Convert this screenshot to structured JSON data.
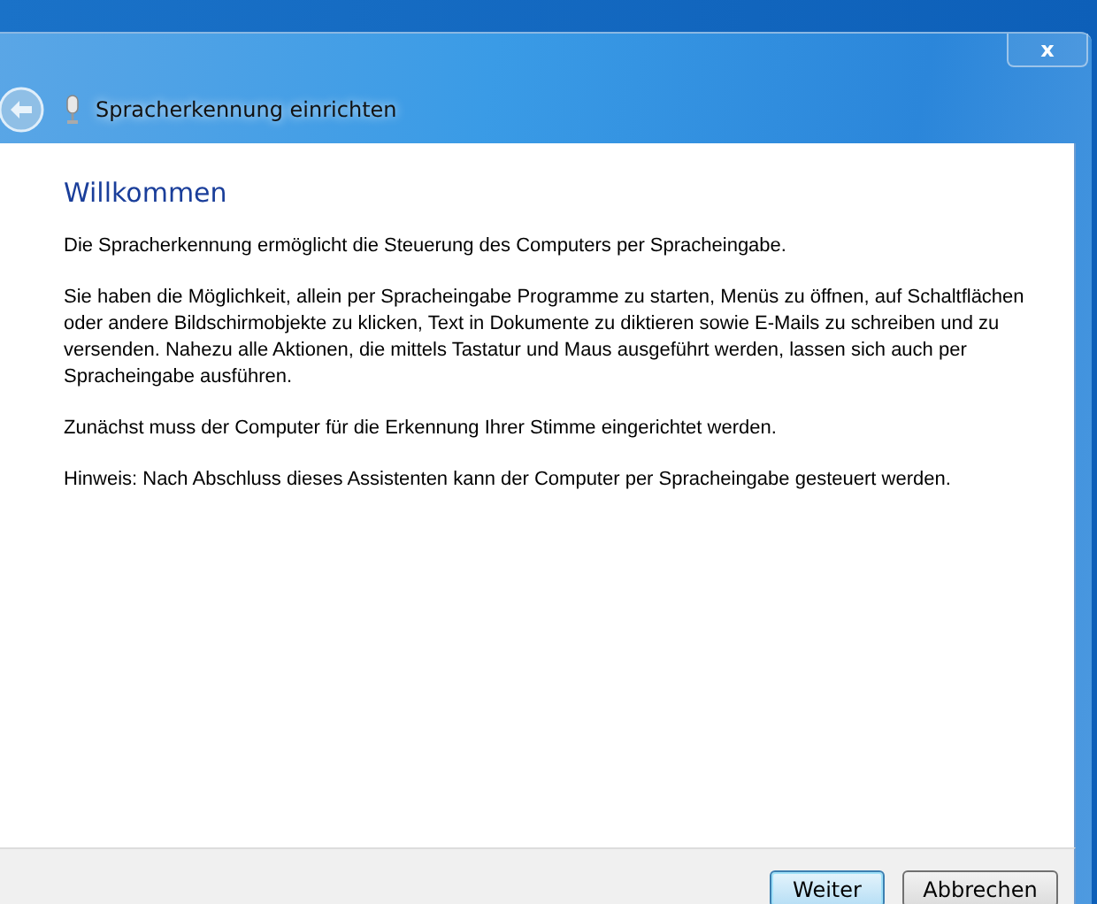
{
  "window": {
    "title": "Spracherkennung einrichten",
    "close_label": "x"
  },
  "page": {
    "heading": "Willkommen",
    "paragraphs": [
      "Die Spracherkennung ermöglicht die Steuerung des Computers per Spracheingabe.",
      "Sie haben die Möglichkeit, allein per Spracheingabe Programme zu starten, Menüs zu öffnen, auf Schaltflächen oder andere Bildschirmobjekte zu klicken, Text in Dokumente zu diktieren sowie E-Mails zu schreiben und zu versenden. Nahezu alle Aktionen, die mittels Tastatur und Maus ausgeführt werden, lassen sich auch per Spracheingabe ausführen.",
      "Zunächst muss der Computer für die Erkennung Ihrer Stimme eingerichtet werden.",
      "Hinweis: Nach Abschluss dieses Assistenten kann der Computer per Spracheingabe gesteuert werden."
    ]
  },
  "buttons": [
    {
      "label": "Weiter",
      "default": true
    },
    {
      "label": "Abbrechen",
      "default": false
    }
  ]
}
